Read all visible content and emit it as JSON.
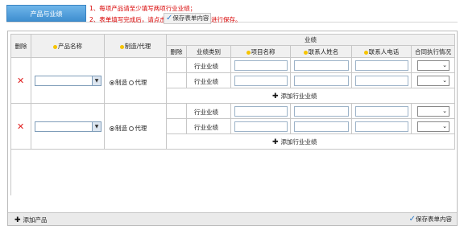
{
  "header": {
    "tab_label": "产品与业绩",
    "tip_line1": "1、每项产品请至少填写两项行业业绩；",
    "tip_line2": "2、表单填写完成后，请点击",
    "tip_save_label": "保存表单内容",
    "tip_line2_end": "进行保存。"
  },
  "table": {
    "headers": {
      "delete": "删除",
      "product_name": "产品名称",
      "mfg_agent": "制造/代理",
      "performance": "业绩",
      "perf_delete": "删除",
      "perf_category": "业绩类别",
      "project_name": "项目名称",
      "contact_name": "联系人姓名",
      "contact_phone": "联系人电话",
      "contract_status": "合同执行情况"
    },
    "products": [
      {
        "radio_mfg": "制造",
        "radio_agent": "代理",
        "selected": "制造",
        "rows": [
          {
            "category": "行业业绩",
            "project": "",
            "contact": "",
            "phone": "",
            "status": ""
          },
          {
            "category": "行业业绩",
            "project": "",
            "contact": "",
            "phone": "",
            "status": ""
          }
        ],
        "add_label": "添加行业业绩"
      },
      {
        "radio_mfg": "制造",
        "radio_agent": "代理",
        "selected": "制造",
        "rows": [
          {
            "category": "行业业绩",
            "project": "",
            "contact": "",
            "phone": "",
            "status": ""
          },
          {
            "category": "行业业绩",
            "project": "",
            "contact": "",
            "phone": "",
            "status": ""
          }
        ],
        "add_label": "添加行业业绩"
      }
    ]
  },
  "footer": {
    "add_product": "添加产品",
    "save_label": "保存表单内容"
  },
  "colors": {
    "tab": "#4f9fdd",
    "tip": "#d80000",
    "delete_x": "#e02020",
    "bulb": "#f6c400"
  }
}
